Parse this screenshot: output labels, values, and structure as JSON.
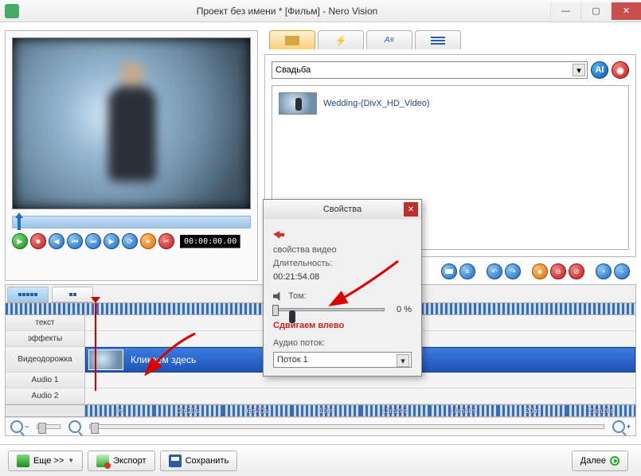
{
  "window": {
    "title": "Проект без имени * [Фильм] - Nero Vision"
  },
  "preview": {
    "timecode": "00:00:00.00"
  },
  "media": {
    "folder": "Свадьба",
    "item": "Wedding-(DivX_HD_Video)"
  },
  "timeline": {
    "row_text": "текст",
    "row_effects": "эффекты",
    "row_video": "Видеодорожка",
    "row_audio1": "Audio 1",
    "row_audio2": "Audio 2",
    "clip_label": "Кликаем здесь",
    "times": [
      "0s",
      "3m20s",
      "6m40s",
      "10m",
      "13m20s",
      "16m40s",
      "20m",
      "23m20s"
    ]
  },
  "bottom": {
    "more": "Еще >>",
    "export": "Экспорт",
    "save": "Сохранить",
    "next": "Далее"
  },
  "dialog": {
    "title": "Свойства",
    "video_props": "свойства видео",
    "duration_label": "Длительность:",
    "duration": "00:21:54.08",
    "tom_label": "Том:",
    "volume_pct": "0 %",
    "shift_left": "Сдвигаем влево",
    "audio_stream_label": "Аудио поток:",
    "audio_stream": "Поток 1"
  }
}
